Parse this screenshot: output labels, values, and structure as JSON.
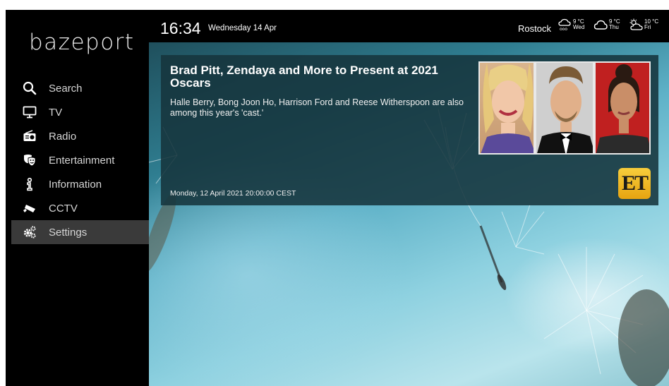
{
  "app": {
    "logo_text": "bazeport"
  },
  "sidebar": {
    "items": [
      {
        "label": "Search",
        "icon": "search-icon",
        "active": false
      },
      {
        "label": "TV",
        "icon": "tv-icon",
        "active": false
      },
      {
        "label": "Radio",
        "icon": "radio-icon",
        "active": false
      },
      {
        "label": "Entertainment",
        "icon": "theater-masks-icon",
        "active": false
      },
      {
        "label": "Information",
        "icon": "info-icon",
        "active": false
      },
      {
        "label": "CCTV",
        "icon": "cctv-camera-icon",
        "active": false
      },
      {
        "label": "Settings",
        "icon": "gears-icon",
        "active": true
      }
    ],
    "accent_color": "#e08a1e"
  },
  "header": {
    "time": "16:34",
    "date": "Wednesday 14 Apr",
    "location": "Rostock",
    "forecast": [
      {
        "temp": "9 °C",
        "day": "Wed",
        "icon": "rain-cloud-icon"
      },
      {
        "temp": "9 °C",
        "day": "Thu",
        "icon": "cloud-icon"
      },
      {
        "temp": "10 °C",
        "day": "Fri",
        "icon": "sun-cloud-icon"
      }
    ]
  },
  "news": {
    "headline": "Brad Pitt, Zendaya and More to Present at 2021 Oscars",
    "summary": "Halle Berry, Bong Joon Ho, Harrison Ford and Reese Witherspoon are also among this year's 'cast.'",
    "timestamp": "Monday, 12 April 2021 20:00:00 CEST",
    "source_logo_text": "ET",
    "photos": [
      "portrait-photo-1",
      "portrait-photo-2",
      "portrait-photo-3"
    ]
  }
}
